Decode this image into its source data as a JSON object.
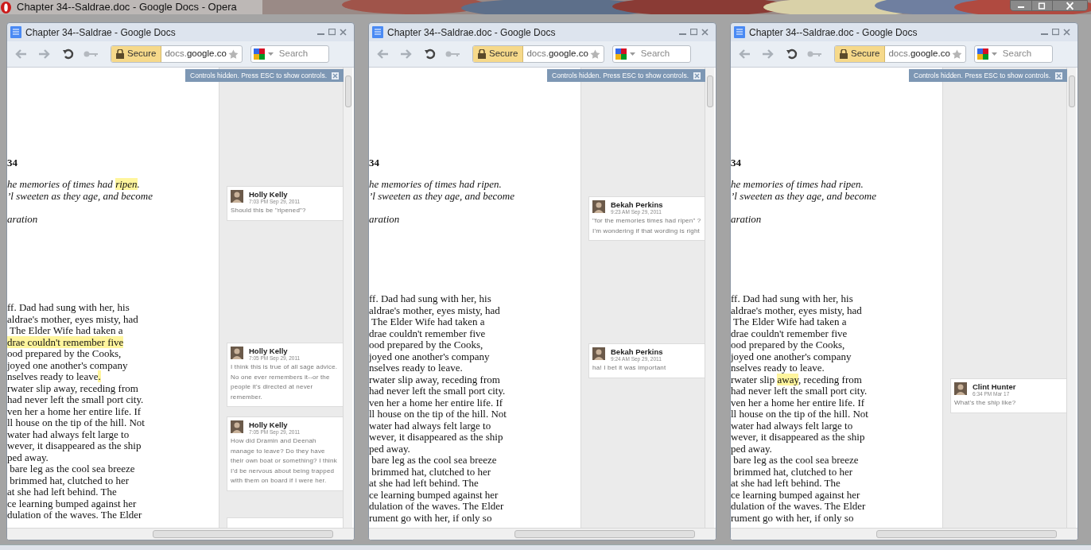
{
  "app_title": "Chapter 34--Saldrae.doc - Google Docs - Opera",
  "windows": [
    {
      "title": "Chapter 34--Saldrae - Google Docs",
      "secure_label": "Secure",
      "address": "docs.**google.co**",
      "search_placeholder": "Search",
      "banner": "Controls hidden. Press ESC to show controls.",
      "heading": "34",
      "epigraph": [
        [
          {
            "text": "he memories of times had ",
            "highlighted": false
          },
          {
            "text": "ripen",
            "highlighted": true
          },
          {
            "text": ".",
            "highlighted": false
          }
        ],
        [
          {
            "text": "’l sweeten as they age, and become",
            "highlighted": false
          }
        ],
        [
          {
            "text": "aration",
            "highlighted": false
          }
        ]
      ],
      "body": [
        [
          {
            "text": "ff. Dad had sung with her, his",
            "highlighted": false
          }
        ],
        [
          {
            "text": "aldrae's mother, eyes misty, had",
            "highlighted": false
          }
        ],
        [
          {
            "text": " The Elder Wife had taken a",
            "highlighted": false
          }
        ],
        [
          {
            "text": "drae couldn't remember five",
            "highlighted": true
          }
        ],
        [
          {
            "text": "ood prepared by the Cooks,",
            "highlighted": false
          }
        ],
        [
          {
            "text": "joyed one another's company",
            "highlighted": false
          }
        ],
        [
          {
            "text": "nselves ready to leave",
            "highlighted": false
          },
          {
            "text": ".",
            "highlighted": true
          }
        ],
        [
          {
            "text": "rwater slip away, receding from",
            "highlighted": false
          }
        ],
        [
          {
            "text": "had never left the small port city.",
            "highlighted": false
          }
        ],
        [
          {
            "text": "ven her a home her entire life. If",
            "highlighted": false
          }
        ],
        [
          {
            "text": "ll house on the tip of the hill. Not",
            "highlighted": false
          }
        ],
        [
          {
            "text": "water had always felt large to",
            "highlighted": false
          }
        ],
        [
          {
            "text": "wever, it disappeared as the ship",
            "highlighted": false
          }
        ],
        [
          {
            "text": "ped away.",
            "highlighted": false
          }
        ],
        [
          {
            "text": " bare leg as the cool sea breeze",
            "highlighted": false
          }
        ],
        [
          {
            "text": " brimmed hat, clutched to her",
            "highlighted": false
          }
        ],
        [
          {
            "text": "at she had left behind. The",
            "highlighted": false
          }
        ],
        [
          {
            "text": "ce learning bumped against her",
            "highlighted": false
          }
        ],
        [
          {
            "text": "dulation of the waves. The Elder",
            "highlighted": false
          }
        ]
      ],
      "comments": [
        {
          "author": "Holly Kelly",
          "time": "7:03 PM Sep 29, 2011",
          "text": "Should this be \"ripened\"?"
        },
        {
          "author": "Holly Kelly",
          "time": "7:05 PM Sep 29, 2011",
          "text": "I think this is true of all sage advice. No one ever remembers it--or the people it's directed at never remember."
        },
        {
          "author": "Holly Kelly",
          "time": "7:05 PM Sep 29, 2011",
          "text": "How did Dramin and Deenah manage to leave? Do they have their own boat or something? I think I'd be nervous about being trapped with them on board if I were her."
        }
      ]
    },
    {
      "title": "Chapter 34--Saldrae.doc - Google Docs",
      "secure_label": "Secure",
      "address": "docs.**google.co**",
      "search_placeholder": "Search",
      "banner": "Controls hidden. Press ESC to show controls.",
      "heading": "34",
      "epigraph": [
        [
          {
            "text": "he memories of times had ripen.",
            "highlighted": false
          }
        ],
        [
          {
            "text": "’l sweeten as they age, and become",
            "highlighted": false
          }
        ],
        [
          {
            "text": "aration",
            "highlighted": false
          }
        ]
      ],
      "body": [
        [
          {
            "text": "ff. Dad had sung with her, his",
            "highlighted": false
          }
        ],
        [
          {
            "text": "aldrae's mother, eyes misty, had",
            "highlighted": false
          }
        ],
        [
          {
            "text": " The Elder Wife had taken a",
            "highlighted": false
          }
        ],
        [
          {
            "text": "drae couldn't remember five",
            "highlighted": false
          }
        ],
        [
          {
            "text": "ood prepared by the Cooks,",
            "highlighted": false
          }
        ],
        [
          {
            "text": "joyed one another's company",
            "highlighted": false
          }
        ],
        [
          {
            "text": "nselves ready to leave.",
            "highlighted": false
          }
        ],
        [
          {
            "text": "rwater slip away, receding from",
            "highlighted": false
          }
        ],
        [
          {
            "text": "had never left the small port city.",
            "highlighted": false
          }
        ],
        [
          {
            "text": "ven her a home her entire life. If",
            "highlighted": false
          }
        ],
        [
          {
            "text": "ll house on the tip of the hill. Not",
            "highlighted": false
          }
        ],
        [
          {
            "text": "water had always felt large to",
            "highlighted": false
          }
        ],
        [
          {
            "text": "wever, it disappeared as the ship",
            "highlighted": false
          }
        ],
        [
          {
            "text": "ped away.",
            "highlighted": false
          }
        ],
        [
          {
            "text": " bare leg as the cool sea breeze",
            "highlighted": false
          }
        ],
        [
          {
            "text": " brimmed hat, clutched to her",
            "highlighted": false
          }
        ],
        [
          {
            "text": "at she had left behind. The",
            "highlighted": false
          }
        ],
        [
          {
            "text": "ce learning bumped against her",
            "highlighted": false
          }
        ],
        [
          {
            "text": "dulation of the waves. The Elder",
            "highlighted": false
          }
        ],
        [
          {
            "text": "rument go with her, if only so",
            "highlighted": false
          }
        ]
      ],
      "comments": [
        {
          "author": "Bekah Perkins",
          "time": "9:23 AM Sep 29, 2011",
          "text": "\"for the memories times had ripen\" ? I'm wondering if that wording is right"
        },
        {
          "author": "Bekah Perkins",
          "time": "9:24 AM Sep 29, 2011",
          "text": "ha! I bet it was important"
        }
      ]
    },
    {
      "title": "Chapter 34--Saldrae.doc - Google Docs",
      "secure_label": "Secure",
      "address": "docs.**google.co**",
      "search_placeholder": "Search",
      "banner": "Controls hidden. Press ESC to show controls.",
      "heading": "34",
      "epigraph": [
        [
          {
            "text": "he memories of times had ripen.",
            "highlighted": false
          }
        ],
        [
          {
            "text": "’l sweeten as they age, and become",
            "highlighted": false
          }
        ],
        [
          {
            "text": "aration",
            "highlighted": false
          }
        ]
      ],
      "body": [
        [
          {
            "text": "ff. Dad had sung with her, his",
            "highlighted": false
          }
        ],
        [
          {
            "text": "aldrae's mother, eyes misty, had",
            "highlighted": false
          }
        ],
        [
          {
            "text": " The Elder Wife had taken a",
            "highlighted": false
          }
        ],
        [
          {
            "text": "drae couldn't remember five",
            "highlighted": false
          }
        ],
        [
          {
            "text": "ood prepared by the Cooks,",
            "highlighted": false
          }
        ],
        [
          {
            "text": "joyed one another's company",
            "highlighted": false
          }
        ],
        [
          {
            "text": "nselves ready to leave.",
            "highlighted": false
          }
        ],
        [
          {
            "text": "rwater slip ",
            "highlighted": false
          },
          {
            "text": "away",
            "highlighted": true
          },
          {
            "text": ", receding from",
            "highlighted": false
          }
        ],
        [
          {
            "text": "had never left the small port city.",
            "highlighted": false
          }
        ],
        [
          {
            "text": "ven her a home her entire life. If",
            "highlighted": false
          }
        ],
        [
          {
            "text": "ll house on the tip of the hill. Not",
            "highlighted": false
          }
        ],
        [
          {
            "text": "water had always felt large to",
            "highlighted": false
          }
        ],
        [
          {
            "text": "wever, it disappeared as the ship",
            "highlighted": false
          }
        ],
        [
          {
            "text": "ped away.",
            "highlighted": false
          }
        ],
        [
          {
            "text": " bare leg as the cool sea breeze",
            "highlighted": false
          }
        ],
        [
          {
            "text": " brimmed hat, clutched to her",
            "highlighted": false
          }
        ],
        [
          {
            "text": "at she had left behind. The",
            "highlighted": false
          }
        ],
        [
          {
            "text": "ce learning bumped against her",
            "highlighted": false
          }
        ],
        [
          {
            "text": "dulation of the waves. The Elder",
            "highlighted": false
          }
        ],
        [
          {
            "text": "rument go with her, if only so",
            "highlighted": false
          }
        ]
      ],
      "comments": [
        {
          "author": "Clint Hunter",
          "time": "6:34 PM Mar 17",
          "text": "What's the ship like?"
        }
      ]
    }
  ]
}
